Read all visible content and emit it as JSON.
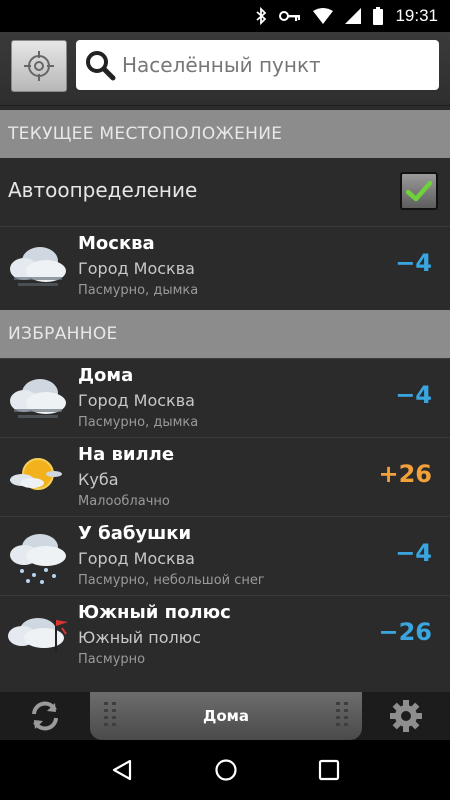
{
  "status_bar": {
    "time": "19:31"
  },
  "search": {
    "placeholder": "Населённый пункт"
  },
  "sections": {
    "current": "ТЕКУЩЕЕ МЕСТОПОЛОЖЕНИЕ",
    "favorites": "ИЗБРАННОЕ"
  },
  "auto_detect": {
    "label": "Автоопределение",
    "checked": true
  },
  "current_location": {
    "name": "Москва",
    "region": "Город Москва",
    "condition": "Пасмурно, дымка",
    "temp": "−4",
    "icon": "overcast-cloud-icon"
  },
  "favorites": [
    {
      "name": "Дома",
      "region": "Город Москва",
      "condition": "Пасмурно, дымка",
      "temp": "−4",
      "icon": "overcast-cloud-icon"
    },
    {
      "name": "На вилле",
      "region": "Куба",
      "condition": "Малооблачно",
      "temp": "+26",
      "icon": "partly-cloudy-sun-icon"
    },
    {
      "name": "У бабушки",
      "region": "Город Москва",
      "condition": "Пасмурно, небольшой снег",
      "temp": "−4",
      "icon": "snow-cloud-icon"
    },
    {
      "name": "Южный полюс",
      "region": "Южный полюс",
      "condition": "Пасмурно",
      "temp": "−26",
      "icon": "cloud-flag-icon"
    }
  ],
  "toolbar": {
    "center_label": "Дома"
  },
  "colors": {
    "cold": "#3aa6e0",
    "warm": "#f2a13a",
    "section_bg": "#8c8c8c"
  }
}
